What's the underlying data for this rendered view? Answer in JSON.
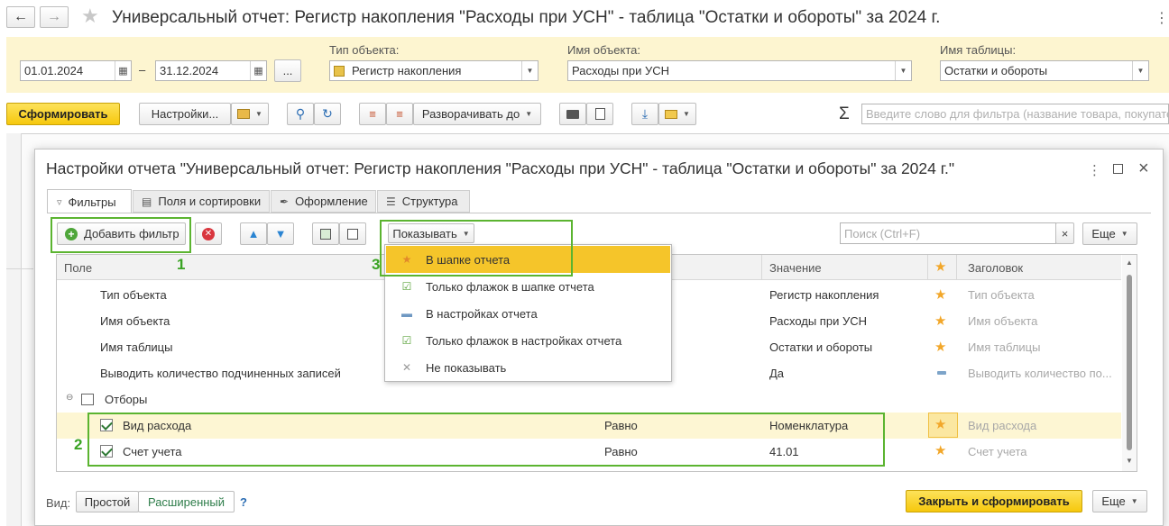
{
  "window": {
    "title": "Универсальный отчет: Регистр накопления \"Расходы при УСН\" - таблица \"Остатки и обороты\" за 2024 г."
  },
  "params": {
    "date_from": "01.01.2024",
    "date_to": "31.12.2024",
    "dash": "–",
    "ellipsis": "...",
    "object_type_label": "Тип объекта:",
    "object_type_value": "Регистр накопления",
    "object_name_label": "Имя объекта:",
    "object_name_value": "Расходы при УСН",
    "table_name_label": "Имя таблицы:",
    "table_name_value": "Остатки и обороты"
  },
  "toolbar": {
    "generate": "Сформировать",
    "settings": "Настройки...",
    "expand_to": "Разворачивать до",
    "filter_placeholder": "Введите слово для фильтра (название товара, покупателя...)"
  },
  "dialog": {
    "title": "Настройки отчета \"Универсальный отчет: Регистр накопления \"Расходы при УСН\" - таблица \"Остатки и обороты\" за 2024 г.\"",
    "tabs": [
      {
        "label": "Фильтры"
      },
      {
        "label": "Поля и сортировки"
      },
      {
        "label": "Оформление"
      },
      {
        "label": "Структура"
      }
    ],
    "add_filter": "Добавить фильтр",
    "show_button": "Показывать",
    "search_placeholder": "Поиск (Ctrl+F)",
    "more": "Еще",
    "columns": {
      "field": "Поле",
      "value": "Значение",
      "header": "Заголовок"
    },
    "rows": [
      {
        "field": "Тип объекта",
        "value": "Регистр накопления",
        "header": "Тип объекта"
      },
      {
        "field": "Имя объекта",
        "value": "Расходы при УСН",
        "header": "Имя объекта"
      },
      {
        "field": "Имя таблицы",
        "value": "Остатки и обороты",
        "header": "Имя таблицы"
      },
      {
        "field": "Выводить количество подчиненных записей",
        "value": "Да",
        "header": "Выводить количество по..."
      }
    ],
    "group": "Отборы",
    "filters": [
      {
        "field": "Вид расхода",
        "condition": "Равно",
        "value": "Номенклатура",
        "header": "Вид расхода"
      },
      {
        "field": "Счет учета",
        "condition": "Равно",
        "value": "41.01",
        "header": "Счет учета"
      }
    ],
    "menu": [
      {
        "label": "В шапке отчета"
      },
      {
        "label": "Только флажок в шапке отчета"
      },
      {
        "label": "В настройках отчета"
      },
      {
        "label": "Только флажок в настройках отчета"
      },
      {
        "label": "Не показывать"
      }
    ],
    "view_label": "Вид:",
    "view_simple": "Простой",
    "view_extended": "Расширенный",
    "help": "?",
    "close_generate": "Закрыть и сформировать",
    "more_bottom": "Еще"
  },
  "annotations": [
    "1",
    "2",
    "3"
  ],
  "colors": {
    "accent_yellow": "#f6c80d",
    "highlight_row": "#fdf6d3",
    "annotation_green": "#5bb430",
    "menu_selected": "#f5c52a"
  }
}
